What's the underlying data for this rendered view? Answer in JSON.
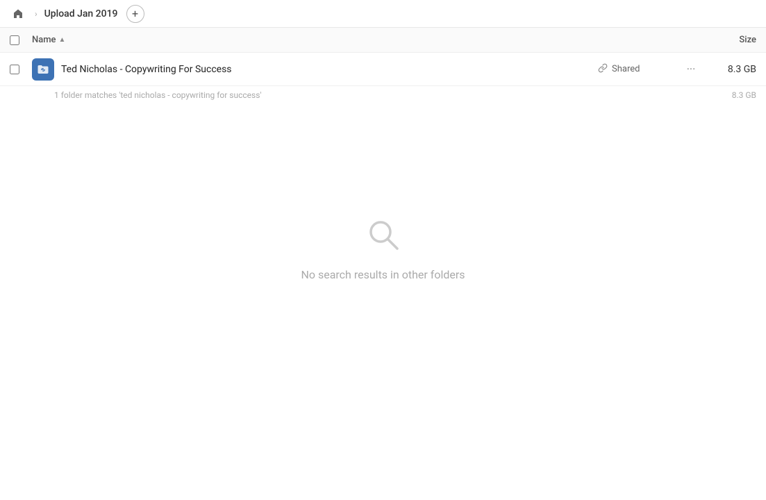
{
  "topbar": {
    "home_icon": "home",
    "breadcrumb_title": "Upload Jan 2019",
    "add_button_label": "+"
  },
  "columns": {
    "name_label": "Name",
    "sort_indicator": "▲",
    "size_label": "Size"
  },
  "file_row": {
    "icon_type": "link-folder",
    "name": "Ted Nicholas - Copywriting For Success",
    "shared_label": "Shared",
    "more_label": "···",
    "size": "8.3 GB"
  },
  "match_summary": {
    "text": "1 folder matches 'ted nicholas - copywriting for success'",
    "size": "8.3 GB"
  },
  "empty_state": {
    "icon": "search",
    "text": "No search results in other folders"
  }
}
